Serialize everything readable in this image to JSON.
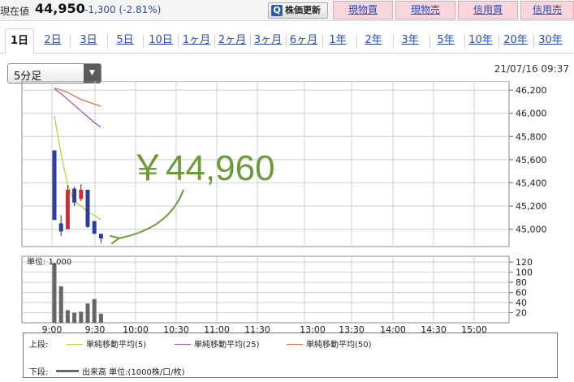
{
  "header": {
    "price_label": "現在値",
    "price": "44,950",
    "change": "-1,300 (-2.81%)",
    "refresh_button": "株価更新",
    "trade_buttons": [
      "現物買",
      "現物売",
      "信用買",
      "信用売"
    ]
  },
  "tabs": [
    "1日",
    "2日",
    "3日",
    "5日",
    "10日",
    "1ヶ月",
    "2ヶ月",
    "3ヶ月",
    "6ヶ月",
    "1年",
    "2年",
    "3年",
    "5年",
    "10年",
    "20年",
    "30年"
  ],
  "active_tab": "1日",
  "interval_select": {
    "value": "5分足"
  },
  "timestamp": "21/07/16 09:37",
  "colors": {
    "up": "#d42a3a",
    "down": "#2a3e9e",
    "ma5": "#b9c93a",
    "ma25": "#9b48c8",
    "ma50": "#cf6a3c",
    "volume": "#666666",
    "annotation": "#6c9a3b",
    "link": "#2d49b6"
  },
  "annotation_text": "￥44,960",
  "volume_unit_label": "単位: 1,000",
  "chart_data": [
    {
      "type": "candlestick",
      "x_ticks": [
        "9:00",
        "9:30",
        "10:00",
        "10:30",
        "11:00",
        "11:30",
        "13:00",
        "13:30",
        "14:00",
        "14:30",
        "15:00"
      ],
      "y_ticks": [
        "45,000",
        "45,200",
        "45,400",
        "45,600",
        "45,800",
        "46,000",
        "46,200"
      ],
      "ylim": [
        44850,
        46250
      ],
      "candles": [
        {
          "time": "9:00",
          "open": 45680,
          "high": 45680,
          "low": 45080,
          "close": 45080
        },
        {
          "time": "9:05",
          "open": 45050,
          "high": 45120,
          "low": 44940,
          "close": 44980
        },
        {
          "time": "9:10",
          "open": 45000,
          "high": 45380,
          "low": 45000,
          "close": 45340
        },
        {
          "time": "9:15",
          "open": 45350,
          "high": 45370,
          "low": 45200,
          "close": 45230
        },
        {
          "time": "9:20",
          "open": 45260,
          "high": 45390,
          "low": 45240,
          "close": 45340
        },
        {
          "time": "9:25",
          "open": 45340,
          "high": 45340,
          "low": 45010,
          "close": 45020
        },
        {
          "time": "9:30",
          "open": 45070,
          "high": 45070,
          "low": 44960,
          "close": 44960
        },
        {
          "time": "9:35",
          "open": 44960,
          "high": 44960,
          "low": 44880,
          "close": 44920
        }
      ],
      "series": [
        {
          "name": "単純移動平均(5)",
          "values": [
            45980,
            45650,
            45380,
            45240,
            45200,
            45150,
            45120,
            45080
          ]
        },
        {
          "name": "単純移動平均(25)",
          "values": [
            46210,
            46170,
            46120,
            46070,
            46020,
            45970,
            45920,
            45880
          ]
        },
        {
          "name": "単純移動平均(50)",
          "values": [
            46220,
            46200,
            46180,
            46150,
            46120,
            46100,
            46080,
            46060
          ]
        }
      ]
    },
    {
      "type": "bar",
      "title": "出来高",
      "y_ticks": [
        "20",
        "40",
        "60",
        "80",
        "100",
        "120"
      ],
      "ylim": [
        0,
        125
      ],
      "categories": [
        "9:00",
        "9:05",
        "9:10",
        "9:15",
        "9:20",
        "9:25",
        "9:30",
        "9:35"
      ],
      "values": [
        118,
        72,
        25,
        20,
        22,
        38,
        47,
        18
      ]
    }
  ],
  "legend": {
    "upper_label": "上段:",
    "lower_label": "下段:",
    "items": [
      "単純移動平均(5)",
      "単純移動平均(25)",
      "単純移動平均(50)"
    ],
    "volume_item": "出来高 単位:(1000株/口/枚)"
  }
}
